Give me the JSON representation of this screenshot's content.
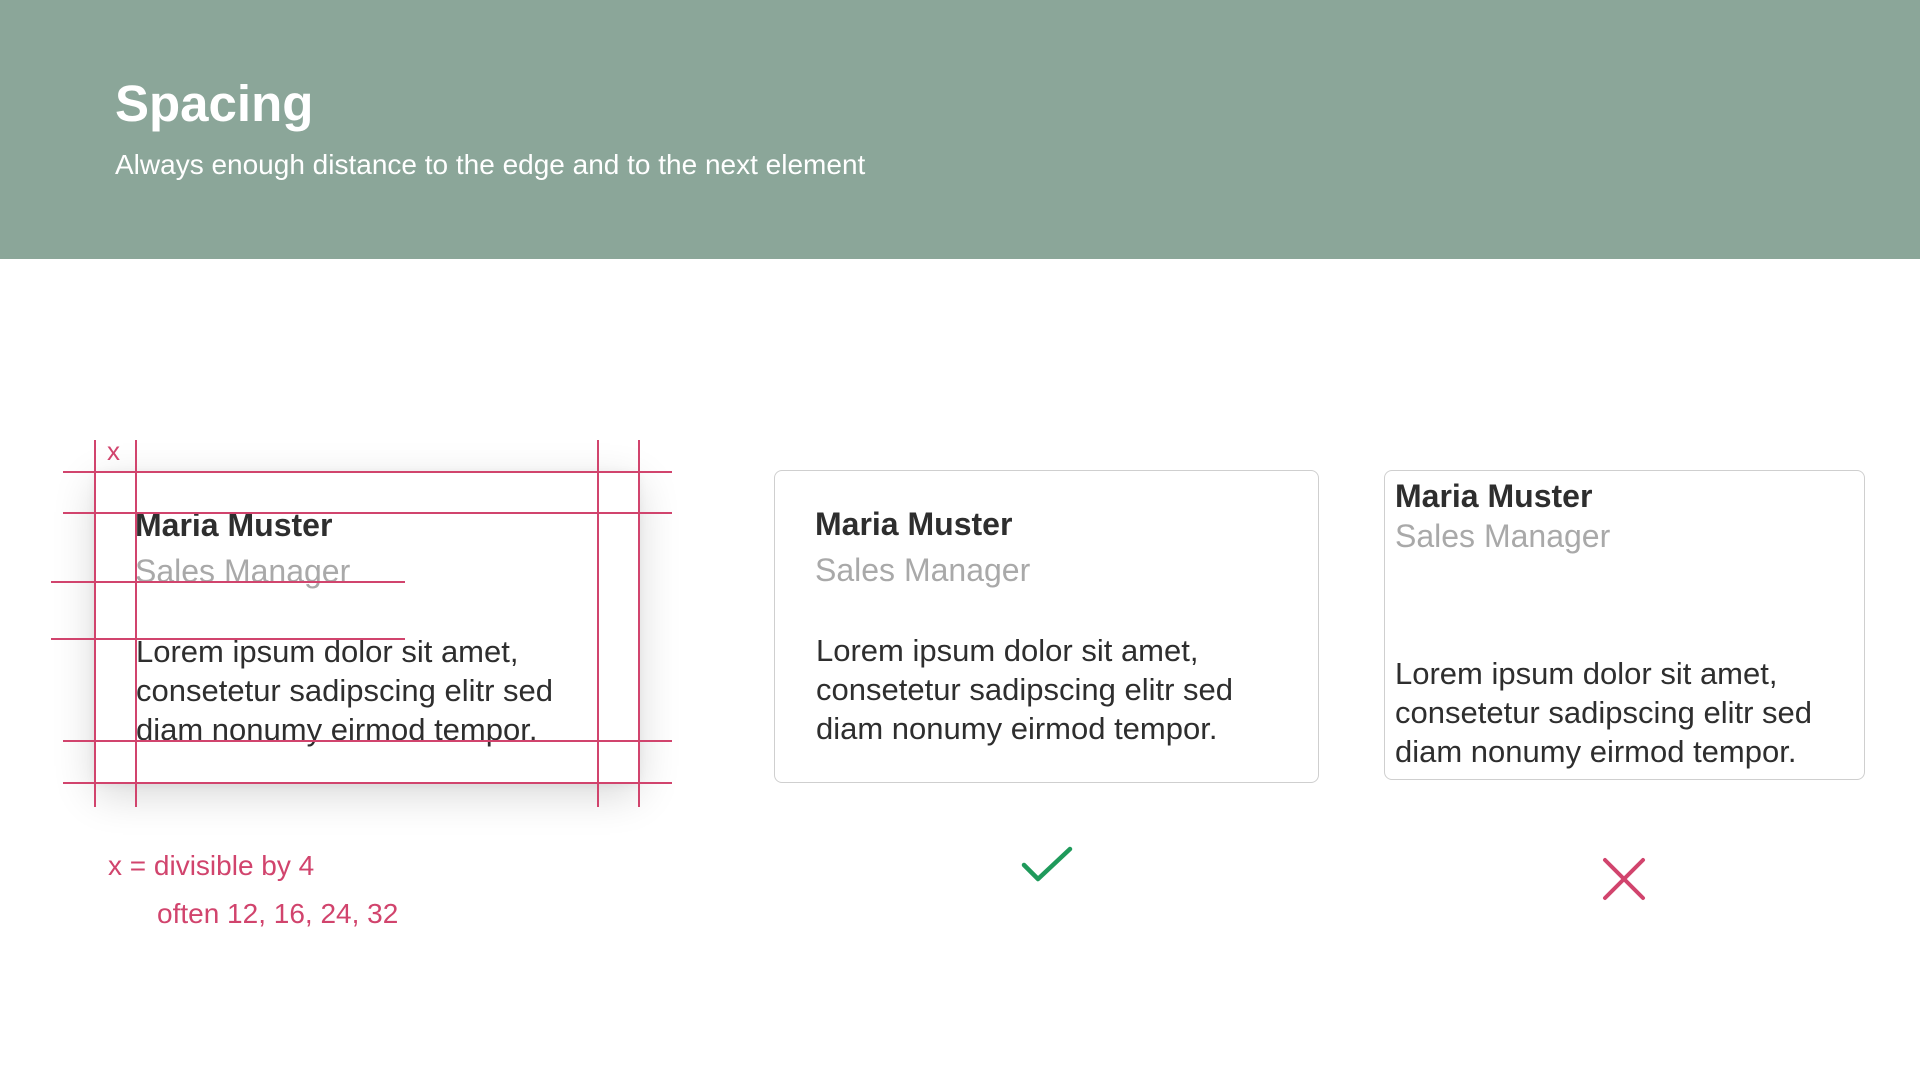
{
  "header": {
    "title": "Spacing",
    "subtitle": "Always enough distance to the edge and to the next element"
  },
  "cards": [
    {
      "name": "Maria Muster",
      "role": "Sales Manager",
      "body_lines": [
        "Lorem ipsum dolor sit amet,",
        "consetetur sadipscing elitr sed",
        "diam nonumy eirmod tempor."
      ]
    },
    {
      "name": "Maria Muster",
      "role": "Sales Manager",
      "body_lines": [
        "Lorem ipsum dolor sit amet,",
        "consetetur sadipscing elitr sed",
        "diam nonumy eirmod tempor."
      ]
    },
    {
      "name": "Maria Muster",
      "role": "Sales Manager",
      "body_lines": [
        "Lorem ipsum dolor sit amet,",
        "consetetur sadipscing elitr sed",
        "diam nonumy eirmod tempor."
      ]
    }
  ],
  "annotation": {
    "x_label": "x",
    "rule": "x = divisible by 4",
    "examples": "often 12, 16, 24, 32"
  },
  "icons": {
    "correct": "checkmark-icon",
    "incorrect": "cross-icon"
  },
  "colors": {
    "header_bg": "#8ba699",
    "guide": "#d1446d",
    "correct": "#1f9a5b",
    "incorrect": "#d1446d"
  }
}
